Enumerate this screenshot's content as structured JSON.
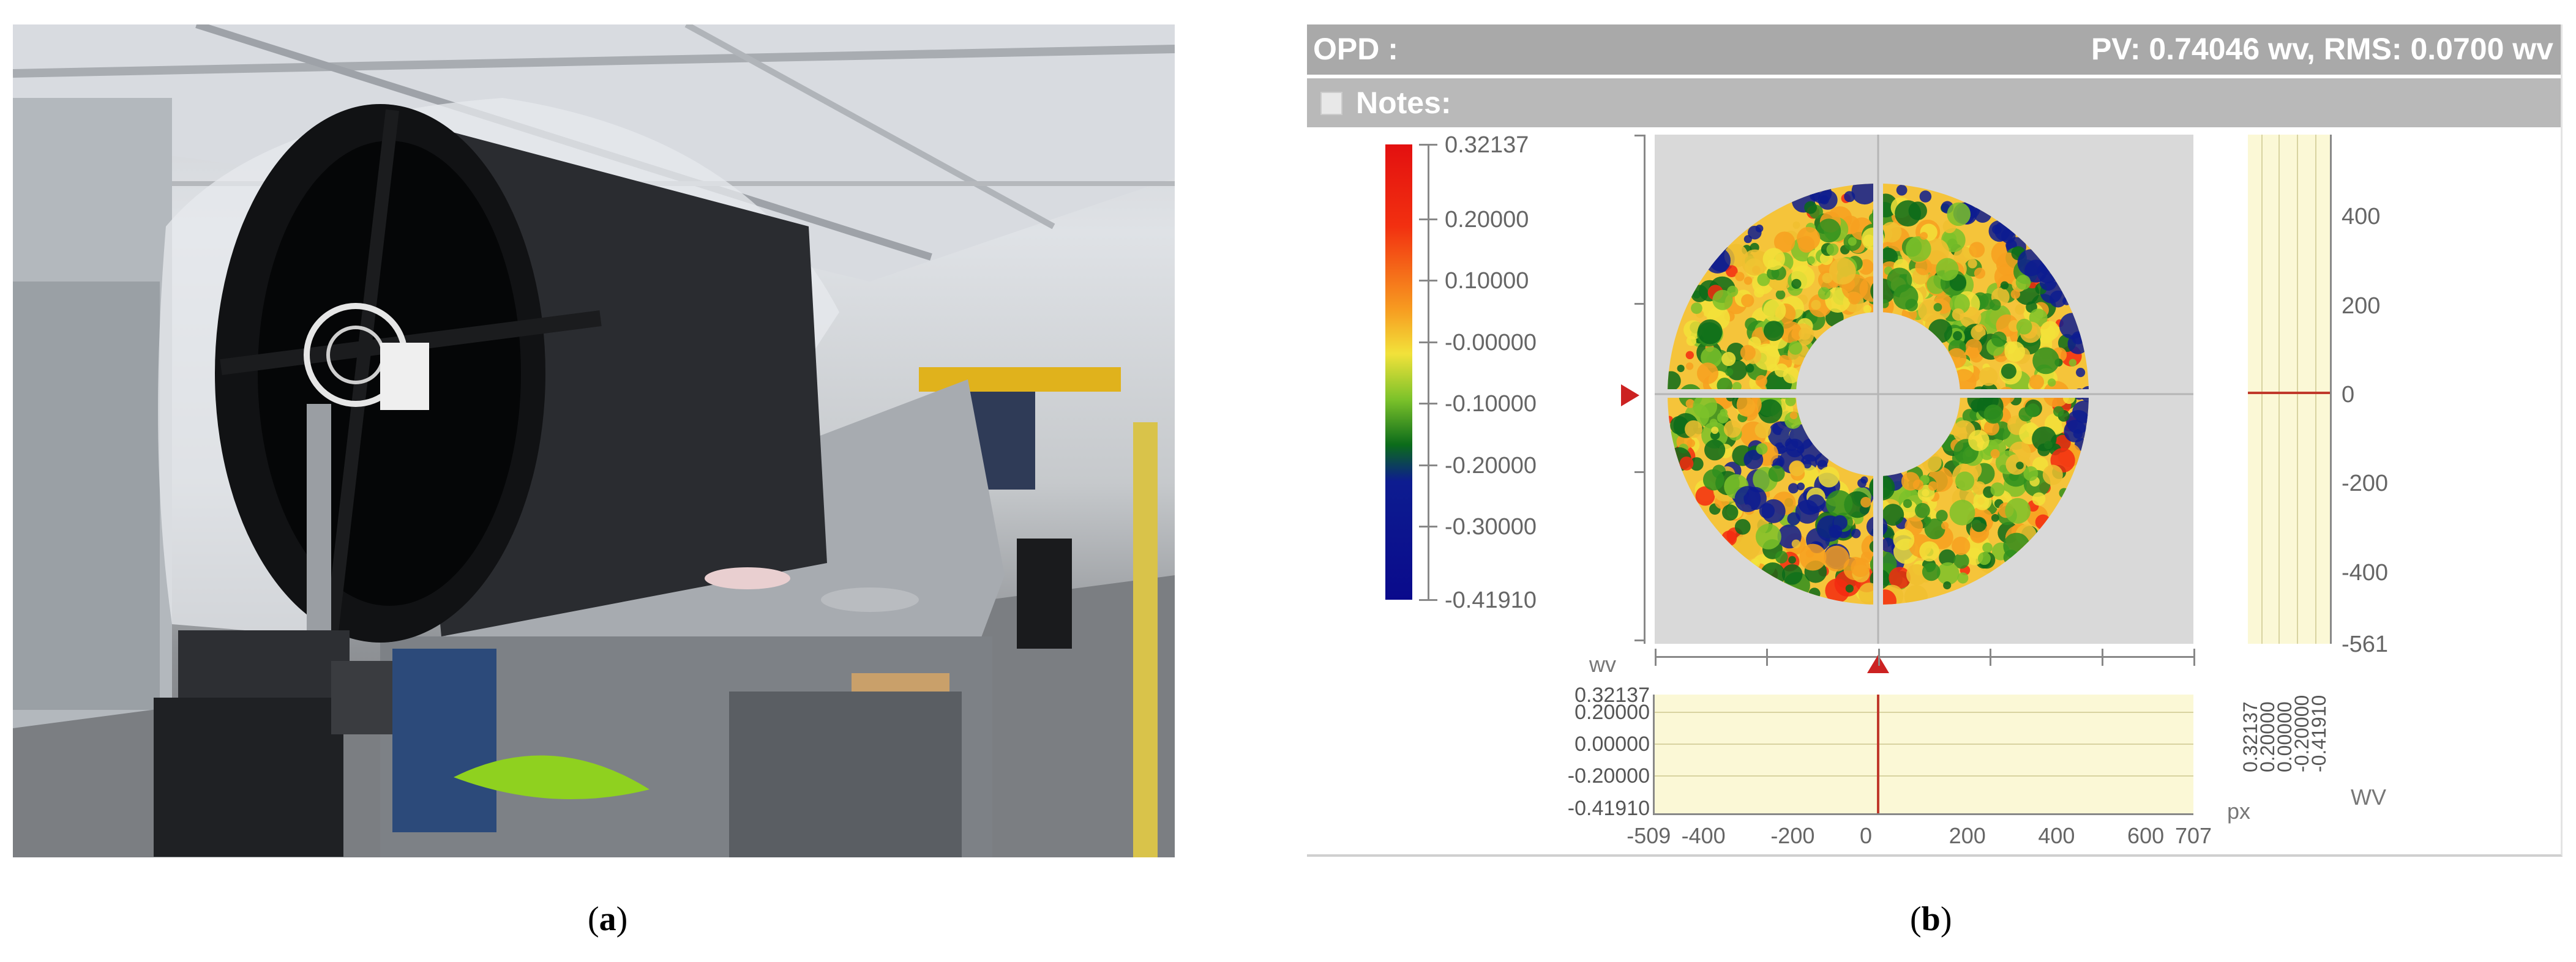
{
  "figure": {
    "captions": [
      {
        "open": "(",
        "letter": "a",
        "close": ")"
      },
      {
        "open": "(",
        "letter": "b",
        "close": ")"
      }
    ]
  },
  "photo": {
    "icon": "telescope-test-setup-photo"
  },
  "opd_panel": {
    "title": "OPD :",
    "stats": "PV: 0.74046 wv, RMS: 0.0700 wv",
    "notes_label": "Notes:",
    "colorbar": {
      "labels": [
        "0.32137",
        "0.20000",
        "0.10000",
        "-0.00000",
        "-0.10000",
        "-0.20000",
        "-0.30000",
        "-0.41910"
      ],
      "values": [
        0.32137,
        0.2,
        0.1,
        0,
        -0.1,
        -0.2,
        -0.3,
        -0.4191
      ],
      "colors": [
        "#0a0a8c",
        "#0d1c90",
        "#0b6b1a",
        "#7cc22a",
        "#f3e93a",
        "#f7a020",
        "#f32a10",
        "#e01010"
      ]
    },
    "map_unit": "wv",
    "right_profile": {
      "y_labels": [
        "400",
        "200",
        "0",
        "-200",
        "-400",
        "-561"
      ],
      "y_values": [
        400,
        200,
        0,
        -200,
        -400,
        -561
      ],
      "x_labels": [
        "0.32137",
        "0.20000",
        "0.00000",
        "-0.20000",
        "-0.41910"
      ],
      "unit": "WV"
    },
    "bottom_profile": {
      "y_labels": [
        "0.32137",
        "0.20000",
        "0.00000",
        "-0.20000",
        "-0.41910"
      ],
      "x_labels": [
        "-509",
        "-400",
        "-200",
        "0",
        "200",
        "400",
        "600",
        "707"
      ],
      "x_values": [
        -509,
        -400,
        -200,
        0,
        200,
        400,
        600,
        707
      ],
      "unit": "px"
    },
    "accent_color": "#cc2222"
  }
}
